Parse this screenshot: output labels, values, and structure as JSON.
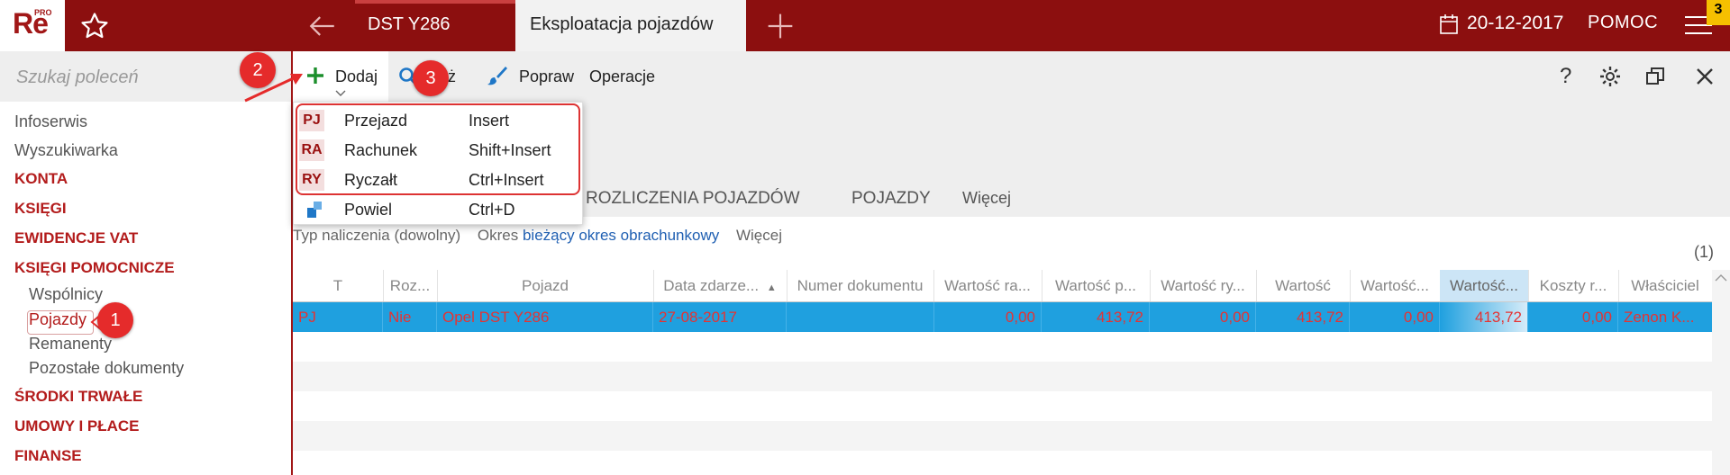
{
  "app": {
    "logo_text": "Re",
    "logo_sup": "PRO"
  },
  "topbar": {
    "tab_doc": "DST Y286",
    "tab_active": "Eksploatacja pojazdów",
    "date": "20-12-2017",
    "help": "POMOC",
    "badge": "3",
    "color": "#8c0f0f"
  },
  "sidebar": {
    "search_placeholder": "Szukaj poleceń",
    "top_items": [
      "Infoserwis",
      "Wyszukiwarka"
    ],
    "sections": {
      "konta": "KONTA",
      "ksiegi": "KSIĘGI",
      "ewidencje": "EWIDENCJE VAT",
      "pomocnicze": "KSIĘGI POMOCNICZE",
      "srodki": "ŚRODKI TRWAŁE",
      "umowy": "UMOWY I PŁACE",
      "finanse": "FINANSE"
    },
    "sub_items": [
      "Wspólnicy",
      "Pojazdy",
      "Remanenty",
      "Pozostałe dokumenty"
    ]
  },
  "toolbar": {
    "add": "Dodaj",
    "show": "każ",
    "edit": "Popraw",
    "ops": "Operacje"
  },
  "dropdown": {
    "items": [
      {
        "code": "PJ",
        "label": "Przejazd",
        "key": "Insert"
      },
      {
        "code": "RA",
        "label": "Rachunek",
        "key": "Shift+Insert"
      },
      {
        "code": "RY",
        "label": "Ryczałt",
        "key": "Ctrl+Insert"
      },
      {
        "code": "",
        "label": "Powiel",
        "key": "Ctrl+D"
      }
    ]
  },
  "tabs": {
    "t1": "ROZLICZENIA POJAZDÓW",
    "t2": "POJAZDY",
    "more": "Więcej"
  },
  "filters": {
    "type": "Typ naliczenia (dowolny)",
    "period_label": "Okres",
    "period_value": "bieżący okres obrachunkowy",
    "more": "Więcej",
    "count": "(1)"
  },
  "grid": {
    "headers": [
      "T",
      "Roz...",
      "Pojazd",
      "Data zdarze...",
      "Numer dokumentu",
      "Wartość ra...",
      "Wartość p...",
      "Wartość ry...",
      "Wartość",
      "Wartość...",
      "Wartość...",
      "Koszty r...",
      "Właściciel"
    ],
    "row": [
      "PJ",
      "Nie",
      "Opel DST Y286",
      "27-08-2017",
      "",
      "0,00",
      "413,72",
      "0,00",
      "413,72",
      "0,00",
      "413,72",
      "0,00",
      "Zenon K..."
    ]
  },
  "callouts": {
    "c1": "1",
    "c2": "2",
    "c3": "3"
  }
}
